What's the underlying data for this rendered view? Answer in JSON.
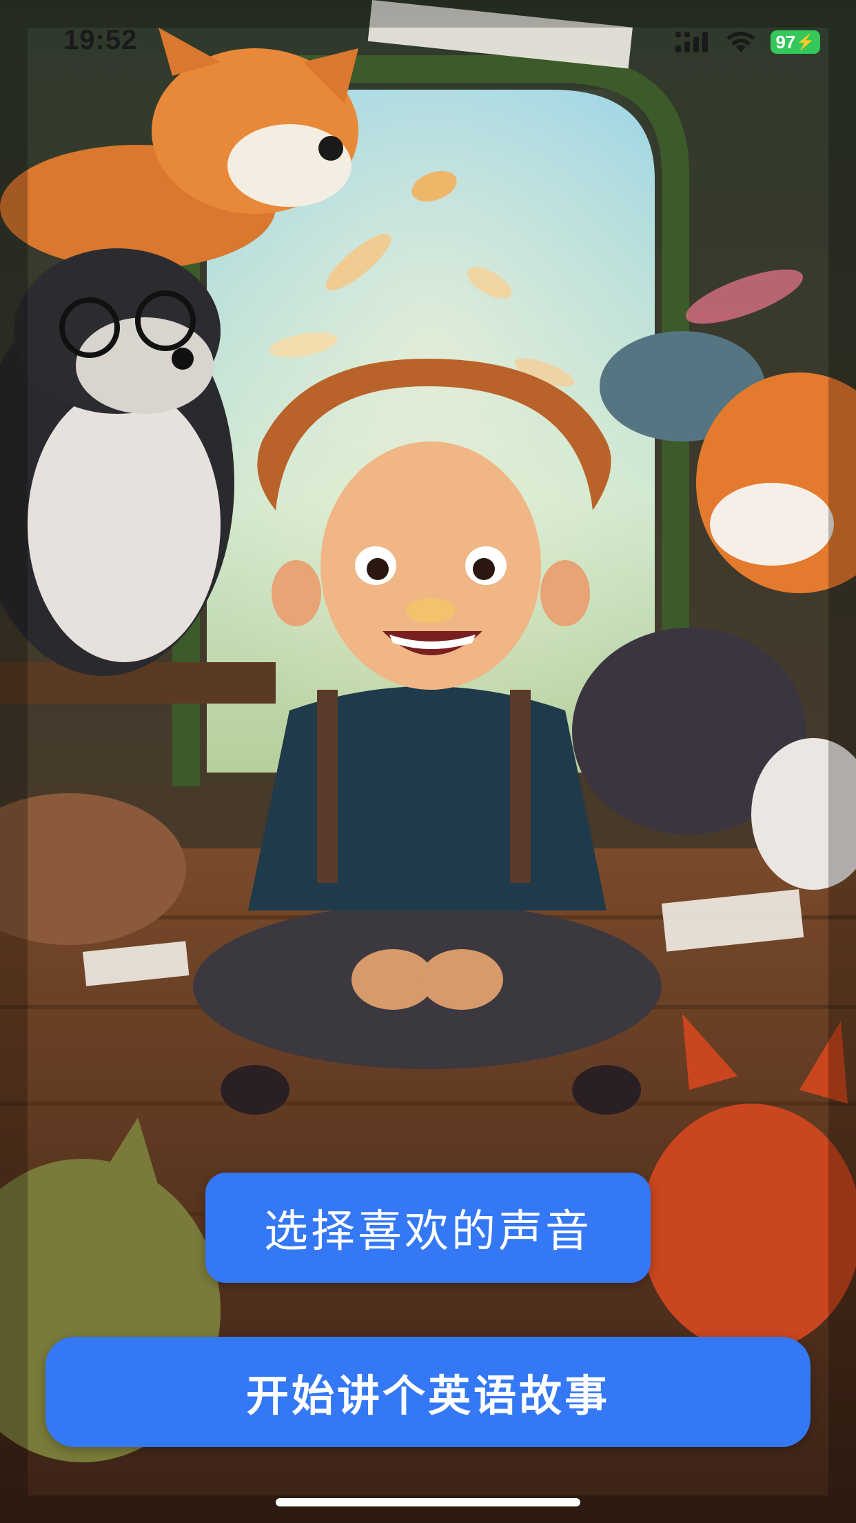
{
  "status_bar": {
    "time": "19:52",
    "battery_level": "97",
    "signal_icon": "cellular-signal-icon",
    "wifi_icon": "wifi-icon",
    "battery_charging_icon": "bolt-icon"
  },
  "background": {
    "image": "illustrated-storybook-scene",
    "palette": {
      "sky": "#a8d8e6",
      "wood": "#6b4226",
      "shadow": "#2b1e16",
      "fox_orange": "#e07a2a"
    }
  },
  "buttons": {
    "choose_voice_label": "选择喜欢的声音",
    "start_story_label": "开始讲个英语故事",
    "accent_color": "#3478f6"
  }
}
